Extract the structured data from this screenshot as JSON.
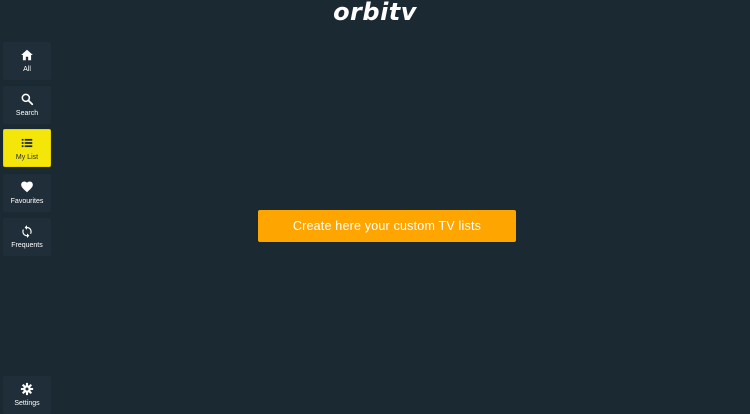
{
  "app": {
    "logo_text": "orbitv"
  },
  "sidebar": {
    "items": [
      {
        "label": "All",
        "icon": "home-icon",
        "active": false
      },
      {
        "label": "Search",
        "icon": "search-icon",
        "active": false
      },
      {
        "label": "My List",
        "icon": "list-icon",
        "active": true
      },
      {
        "label": "Favourites",
        "icon": "heart-icon",
        "active": false
      },
      {
        "label": "Frequents",
        "icon": "refresh-icon",
        "active": false
      }
    ],
    "settings": {
      "label": "Settings",
      "icon": "gear-icon"
    }
  },
  "main": {
    "cta_label": "Create here your custom TV lists"
  },
  "colors": {
    "background": "#1b2932",
    "active_item": "#f5e60a",
    "cta": "#ffa500"
  }
}
